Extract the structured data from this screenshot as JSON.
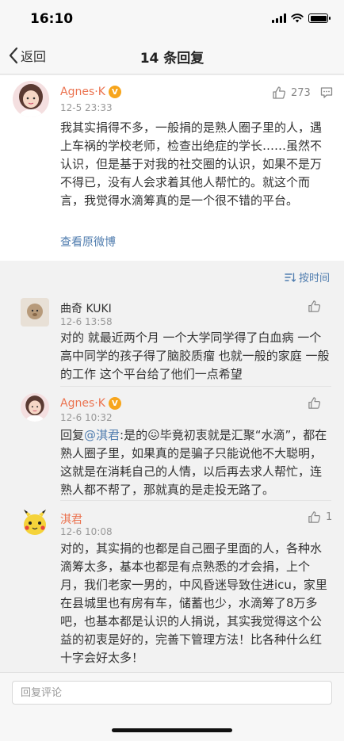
{
  "status_bar": {
    "time": "16:10"
  },
  "nav": {
    "back_label": "返回",
    "title": "14 条回复"
  },
  "root_comment": {
    "author": "Agnes·K",
    "badge": "V",
    "time": "12-5 23:33",
    "likes": "273",
    "text": "我其实捐得不多，一般捐的是熟人圈子里的人，遇上车祸的学校老师，检查出绝症的学长……虽然不认识，但是基于对我的社交圈的认识，如果不是万不得已，没有人会求着其他人帮忙的。就这个而言，我觉得水滴筹真的是一个很不错的平台。",
    "view_original": "查看原微博"
  },
  "sort": {
    "label": "按时间"
  },
  "replies": [
    {
      "author": "曲奇 KUKI",
      "time": "12-6 13:58",
      "text": "对的  就最近两个月 一个大学同学得了白血病 一个高中同学的孩子得了脑胶质瘤  也就一般的家庭 一般的工作  这个平台给了他们一点希望"
    },
    {
      "author": "Agnes·K",
      "badge": "V",
      "time": "12-6 10:32",
      "prefix": "回复",
      "mention": "@淇君",
      "text_before_emoji": ":是的",
      "emoji": "😖",
      "text": "毕竟初衷就是汇聚“水滴”，都在熟人圈子里，如果真的是骗子只能说他不大聪明，这就是在消耗自己的人情，以后再去求人帮忙，连熟人都不帮了，那就真的是走投无路了。"
    },
    {
      "author": "淇君",
      "time": "12-6 10:08",
      "likes": "1",
      "text": "对的，其实捐的也都是自己圈子里面的人，各种水滴筹太多，基本也都是有点熟悉的才会捐，上个月，我们老家一男的，中风昏迷导致住进icu，家里在县城里也有房有车，储蓄也少，水滴筹了8万多吧，也基本都是认识的人捐说，其实我觉得这个公益的初衷是好的，完善下管理方法！比各种什么红十字会好太多！"
    }
  ],
  "footer": {
    "input_placeholder": "回复评论"
  },
  "colors": {
    "author": "#eb7350",
    "link": "#507daf",
    "badge": "#f7a51c"
  }
}
